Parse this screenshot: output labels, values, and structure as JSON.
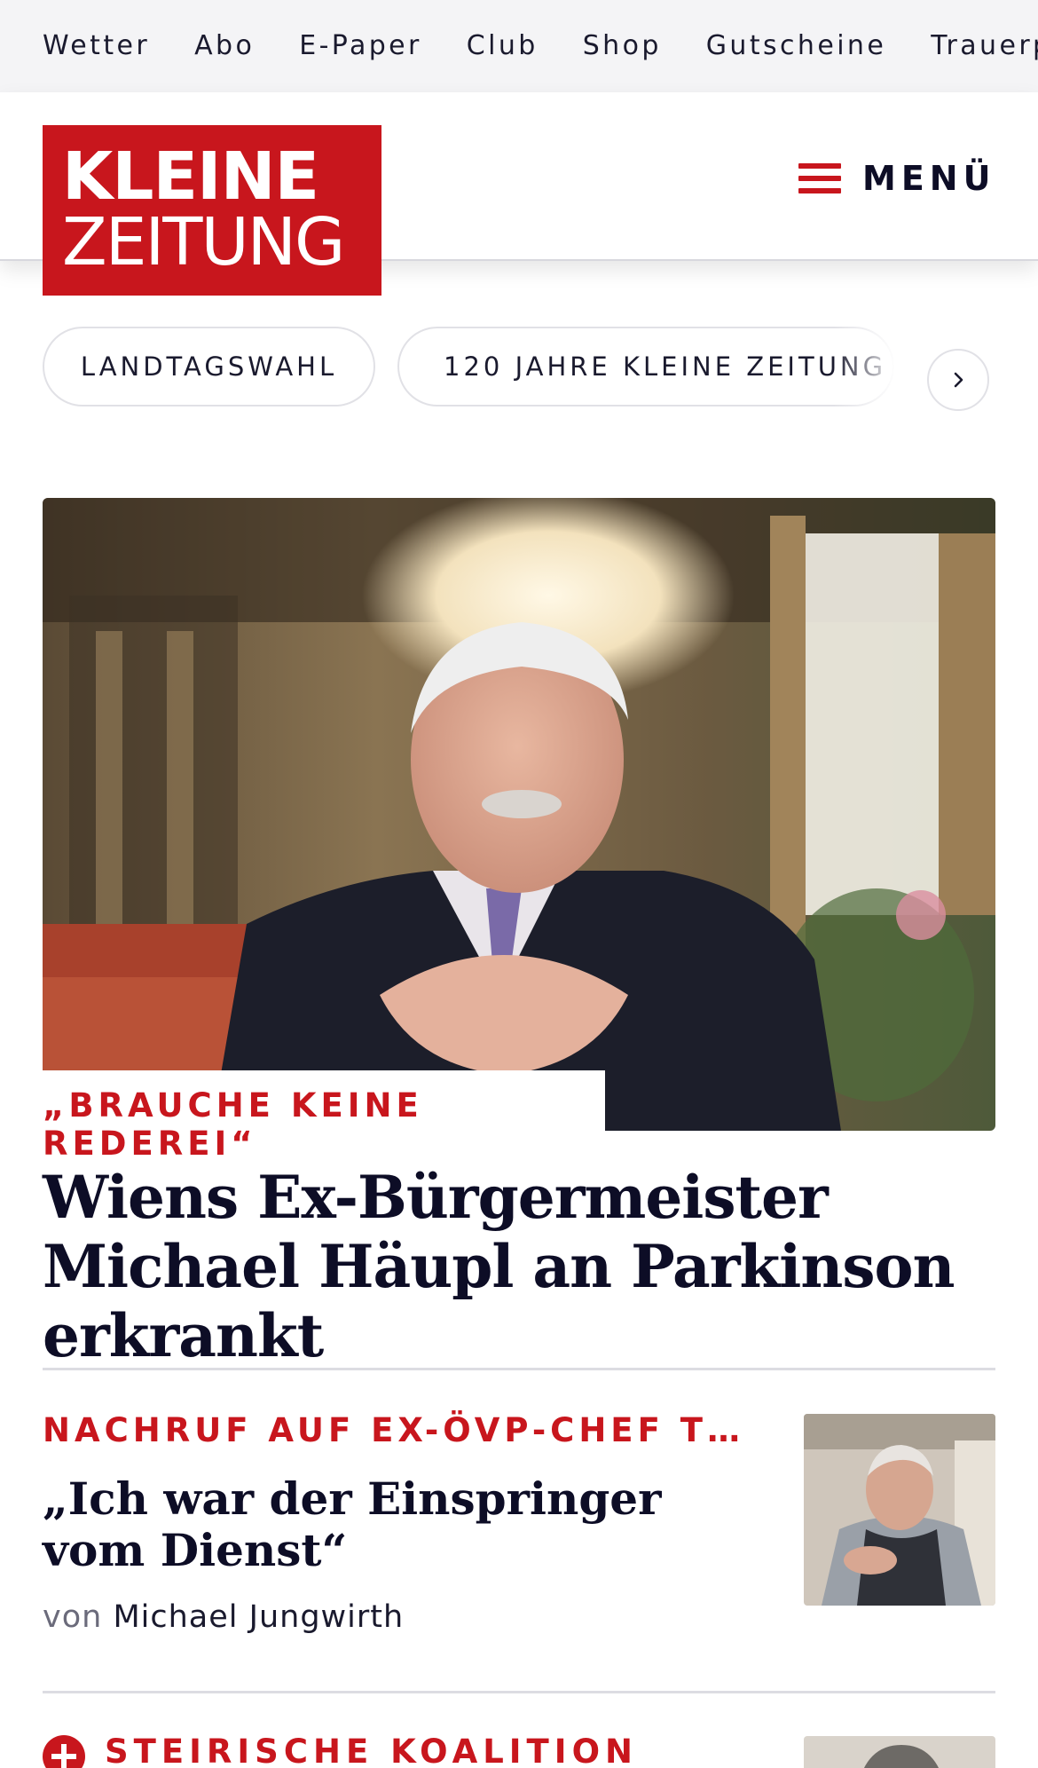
{
  "topnav": {
    "items": [
      "Wetter",
      "Abo",
      "E-Paper",
      "Club",
      "Shop",
      "Gutscheine",
      "Trauerportal"
    ]
  },
  "header": {
    "logo_line1": "KLEINE",
    "logo_line2": "ZEITUNG",
    "menu_label": "MENÜ"
  },
  "topics": {
    "pills": [
      "LANDTAGSWAHL",
      "120 JAHRE KLEINE ZEITUNG"
    ]
  },
  "hero": {
    "kicker": "„BRAUCHE KEINE REDEREI“",
    "title": "Wiens Ex-Bürgermeister Michael Häupl an Parkinson erkrankt"
  },
  "teasers": [
    {
      "kicker": "NACHRUF AUF EX-ÖVP-CHEF T…",
      "title": "„Ich war der Einspringer vom Dienst“",
      "byline_prefix": "von",
      "author": "Michael Jungwirth"
    },
    {
      "kicker": "STEIRISCHE KOALITION"
    }
  ],
  "colors": {
    "brand_red": "#c8161d",
    "headline_navy": "#0d0d26",
    "topnav_bg": "#f4f4f6"
  },
  "icons": {
    "menu": "hamburger-icon",
    "next": "chevron-right-icon",
    "premium": "plus-icon"
  }
}
